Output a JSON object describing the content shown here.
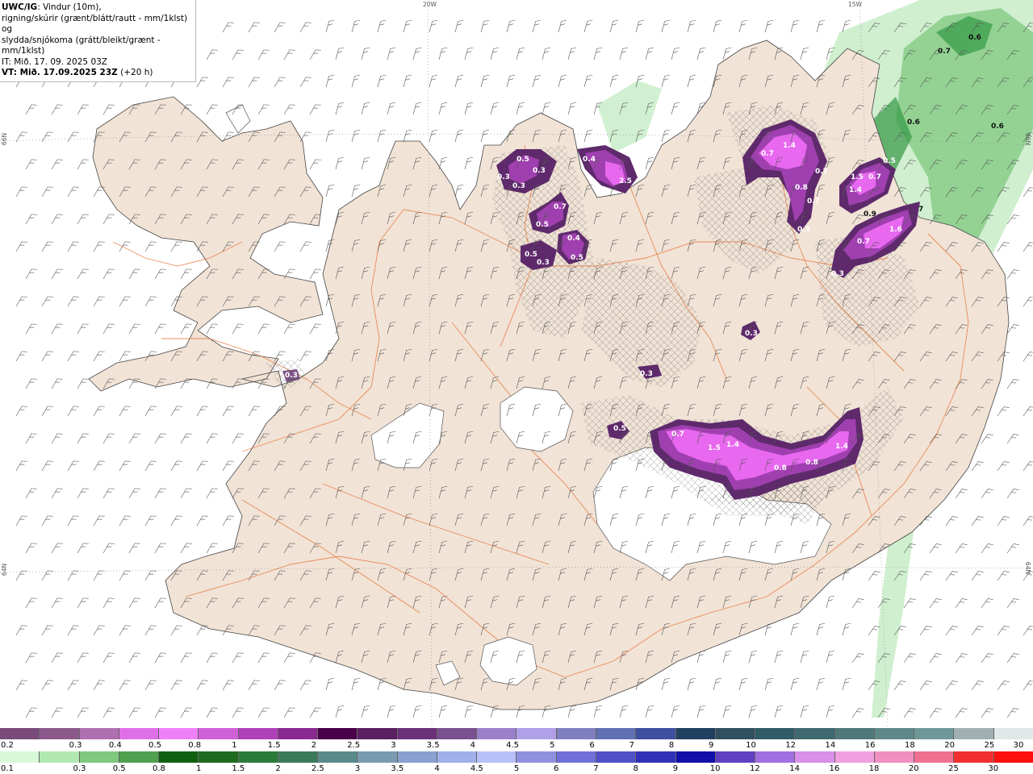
{
  "header": {
    "title_bold": "UWC/IG",
    "title_rest": ": Vindur (10m),",
    "line2": "rigning/skúrir (grænt/blátt/rautt - mm/1klst) og",
    "line3": "slydda/snjókoma (grátt/bleikt/grænt - mm/1klst)",
    "line4": "IT: Mið. 17. 09. 2025 03Z",
    "line5_bold": "VT: Mið. 17.09.2025 23Z",
    "line5_rest": " (+20 h)"
  },
  "grid_labels": {
    "lon_20w": "20W",
    "lon_15w": "15W",
    "lat_66n_left": "66N",
    "lat_66n_right": "66N",
    "lat_64n_left": "64N",
    "lat_64n_right": "64N"
  },
  "colors": {
    "land": "#f1e3d6",
    "roads": "#e8743a",
    "glacier": "#ffffff",
    "sea": "#ffffff",
    "rain_green_light": "#cceecc",
    "rain_green_mid": "#88cc88",
    "rain_green_dark": "#339944",
    "snow_purple_dark": "#5e2a6b",
    "snow_purple_mid": "#a040b0",
    "snow_pink": "#e868f0"
  },
  "precip_values": {
    "snow": [
      "0.5",
      "0.3",
      "0.3",
      "0.3",
      "0.4",
      "2.5",
      "0.7",
      "0.5",
      "0.4",
      "0.5",
      "0.3",
      "0.5",
      "0.7",
      "1.4",
      "0.7",
      "0.8",
      "0.7",
      "0.3",
      "1.5",
      "0.7",
      "1.4",
      "0.5",
      "0.7",
      "1.6",
      "0.3",
      "0.3",
      "0.3",
      "0.3",
      "0.5",
      "0.7",
      "1.5",
      "1.4",
      "0.8",
      "0.8",
      "1.4"
    ],
    "rain": [
      "0.6",
      "0.7",
      "0.6",
      "0.6",
      "0.9",
      "7"
    ]
  },
  "legend": {
    "snow_labels": [
      "0.2",
      "0.3",
      "0.4",
      "0.5",
      "0.8",
      "1",
      "1.5",
      "2",
      "2.5",
      "3",
      "3.5",
      "4",
      "4.5",
      "5",
      "6",
      "7",
      "8",
      "9",
      "10",
      "12",
      "14",
      "16",
      "18",
      "20",
      "25",
      "30"
    ],
    "snow_colors": [
      "#7a4a7a",
      "#8b5a8b",
      "#b070b0",
      "#e070e8",
      "#f080f8",
      "#d060d8",
      "#b040b8",
      "#8a2a90",
      "#4a004a",
      "#5a2060",
      "#6a3078",
      "#7a5090",
      "#9a80c8",
      "#b0a0e8",
      "#8080c0",
      "#6070b0",
      "#4050a0",
      "#204060",
      "#305060",
      "#305c68",
      "#406870",
      "#507878",
      "#608888",
      "#709898",
      "#a0b0b0",
      "#e0e8e8"
    ],
    "rain_labels": [
      "0.1",
      "0.3",
      "0.5",
      "0.8",
      "1",
      "1.5",
      "2",
      "2.5",
      "3",
      "3.5",
      "4",
      "4.5",
      "5",
      "6",
      "7",
      "8",
      "9",
      "10",
      "12",
      "14",
      "16",
      "18",
      "20",
      "25",
      "30"
    ],
    "rain_colors": [
      "#d8f8d8",
      "#b0e8b0",
      "#80c880",
      "#50a050",
      "#106010",
      "#206a20",
      "#2a7a3a",
      "#3a7a5a",
      "#5a8a8a",
      "#7a9ab0",
      "#8aa0d0",
      "#a0b0e8",
      "#b8c0f8",
      "#9090e0",
      "#7070d8",
      "#5050c8",
      "#3030b8",
      "#1010a8",
      "#6040c0",
      "#a070e0",
      "#d890e8",
      "#f0a0e0",
      "#f090c0",
      "#f07090",
      "#f03030",
      "#ff1010"
    ]
  }
}
